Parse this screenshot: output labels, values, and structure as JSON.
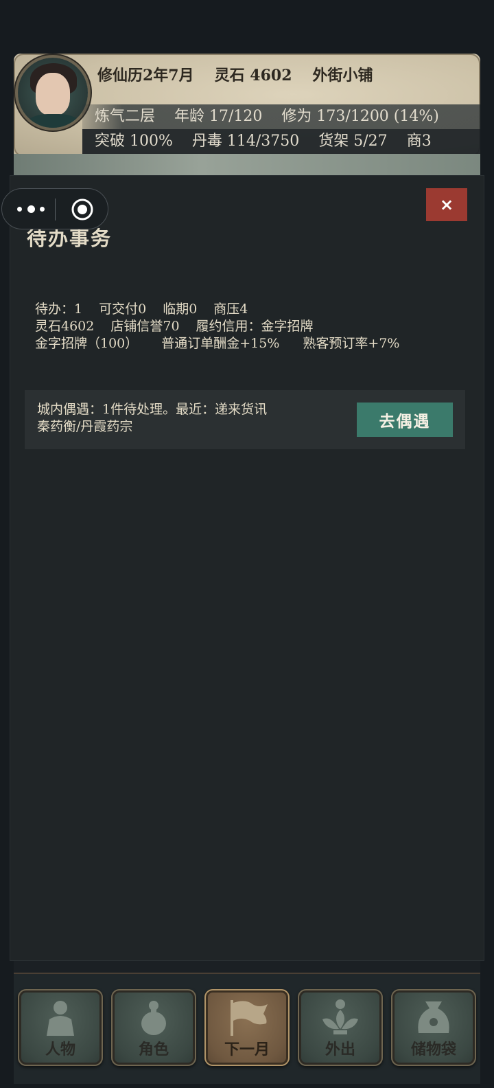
{
  "hud": {
    "calendar": "修仙历2年7月",
    "spirit_stone": "灵石 4602",
    "location": "外街小铺",
    "realm": "炼气二层",
    "age": "年龄 17/120",
    "cultivation": "修为 173/1200 (14%)",
    "breakthrough": "突破 100%",
    "pill_toxin": "丹毒 114/3750",
    "shelf": "货架 5/27",
    "merchant": "商3"
  },
  "modal": {
    "title": "待办事务",
    "close_label": "×",
    "stats": {
      "todo": "待办：1",
      "deliverable": "可交付0",
      "due": "临期0",
      "pressure": "商压4",
      "stones": "灵石4602",
      "reputation": "店铺信誉70",
      "credit": "履约信用：金字招牌",
      "tier": "金字招牌（100）",
      "order_bonus": "普通订单酬金+15%",
      "regular_rate": "熟客预订率+7%"
    },
    "encounter": {
      "line1": "城内偶遇：1件待处理。最近：递来货讯",
      "line2": "秦药衡/丹霞药宗",
      "button_label": "去偶遇",
      "button_color": "#3b7a6b"
    }
  },
  "nav": {
    "items": [
      {
        "label": "人物",
        "icon": "person-icon"
      },
      {
        "label": "角色",
        "icon": "gourd-icon"
      },
      {
        "label": "下一月",
        "icon": "flag-icon",
        "active": true
      },
      {
        "label": "外出",
        "icon": "lotus-icon"
      },
      {
        "label": "储物袋",
        "icon": "bag-icon"
      }
    ]
  },
  "colors": {
    "modal_bg": "#202527",
    "close_button": "#9b3a31",
    "text": "#e3dbc6"
  }
}
